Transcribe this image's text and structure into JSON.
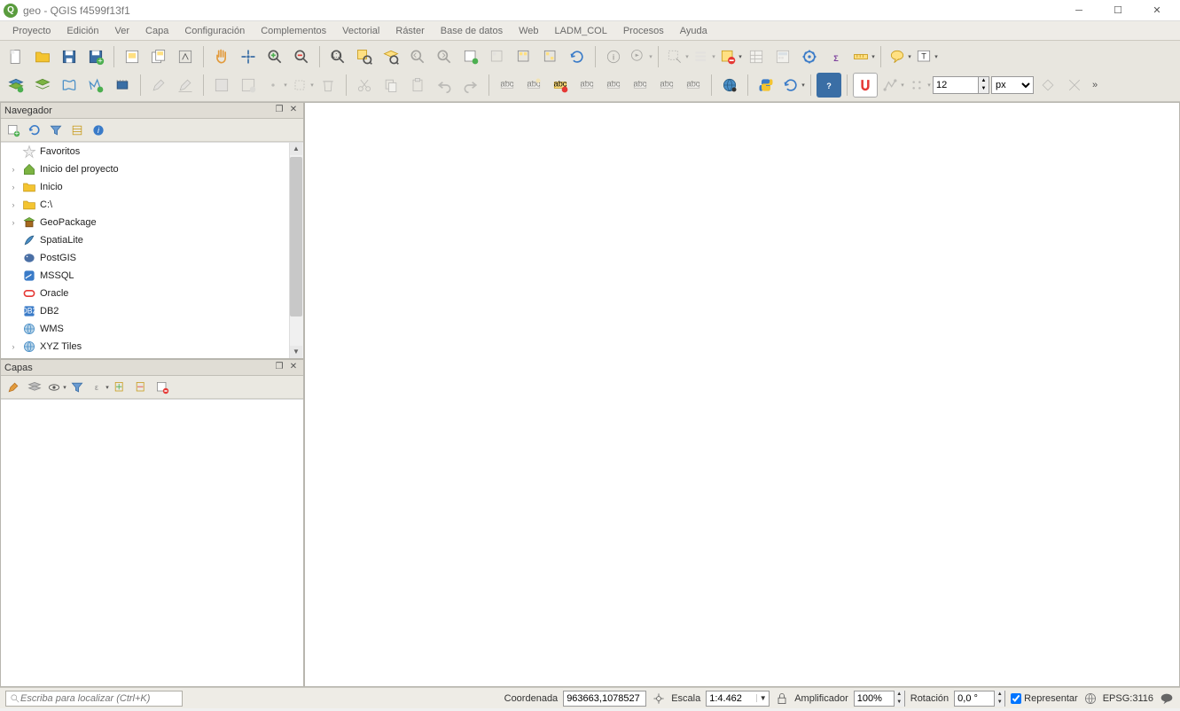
{
  "title": "geo - QGIS f4599f13f1",
  "menu": [
    "Proyecto",
    "Edición",
    "Ver",
    "Capa",
    "Configuración",
    "Complementos",
    "Vectorial",
    "Ráster",
    "Base de datos",
    "Web",
    "LADM_COL",
    "Procesos",
    "Ayuda"
  ],
  "snap_value": "12",
  "snap_unit": "px",
  "browser": {
    "title": "Navegador",
    "items": [
      {
        "label": "Favoritos",
        "icon": "star",
        "expand": ""
      },
      {
        "label": "Inicio del proyecto",
        "icon": "home-green",
        "expand": "›"
      },
      {
        "label": "Inicio",
        "icon": "folder",
        "expand": "›"
      },
      {
        "label": "C:\\",
        "icon": "folder",
        "expand": "›"
      },
      {
        "label": "GeoPackage",
        "icon": "geopackage",
        "expand": "›"
      },
      {
        "label": "SpatiaLite",
        "icon": "feather",
        "expand": ""
      },
      {
        "label": "PostGIS",
        "icon": "elephant",
        "expand": ""
      },
      {
        "label": "MSSQL",
        "icon": "mssql",
        "expand": ""
      },
      {
        "label": "Oracle",
        "icon": "oracle",
        "expand": ""
      },
      {
        "label": "DB2",
        "icon": "db2",
        "expand": ""
      },
      {
        "label": "WMS",
        "icon": "globe",
        "expand": ""
      },
      {
        "label": "XYZ Tiles",
        "icon": "globe",
        "expand": "›"
      }
    ]
  },
  "layers": {
    "title": "Capas"
  },
  "status": {
    "search_placeholder": "Escriba para localizar (Ctrl+K)",
    "coord_label": "Coordenada",
    "coord_value": "963663,1078527",
    "scale_label": "Escala",
    "scale_value": "1:4.462",
    "magnifier_label": "Amplificador",
    "magnifier_value": "100%",
    "rotation_label": "Rotación",
    "rotation_value": "0,0 °",
    "render_label": "Representar",
    "crs_label": "EPSG:3116"
  }
}
